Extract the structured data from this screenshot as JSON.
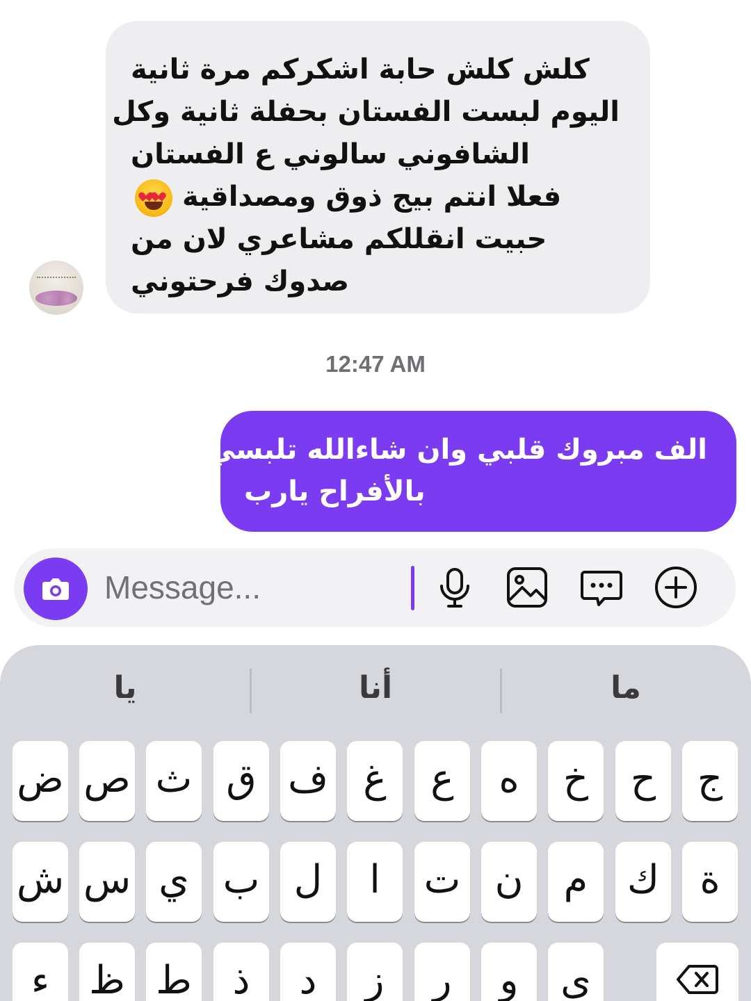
{
  "incoming": {
    "lines": [
      "كلش كلش حابة اشكركم مرة ثانية",
      "اليوم لبست الفستان بحفلة ثانية وكل",
      "الشافوني سالوني ع الفستان",
      "فعلا انتم بيج ذوق ومصداقية",
      "حبيت انقللكم مشاعري  لان من",
      "صدوك فرحتوني"
    ],
    "emoji": "heart-eyes-emoji"
  },
  "timestamp": "12:47 AM",
  "outgoing": {
    "lines": [
      "الف مبروك قلبي وان شاءالله تلبسي",
      "بالأفراح يارب"
    ]
  },
  "composer": {
    "placeholder": "Message...",
    "icons": [
      "camera-icon",
      "microphone-icon",
      "gallery-icon",
      "sticker-chat-icon",
      "plus-circle-icon"
    ]
  },
  "keyboard": {
    "suggestions": [
      "يا",
      "أنا",
      "ما"
    ],
    "row1": [
      "ض",
      "ص",
      "ث",
      "ق",
      "ف",
      "غ",
      "ع",
      "ه",
      "خ",
      "ح",
      "ج"
    ],
    "row2": [
      "ش",
      "س",
      "ي",
      "ب",
      "ل",
      "ا",
      "ت",
      "ن",
      "م",
      "ك",
      "ة"
    ],
    "row3": [
      "ء",
      "ظ",
      "ط",
      "ذ",
      "د",
      "ز",
      "ر",
      "و",
      "ى"
    ],
    "delete_icon": "delete-icon"
  },
  "colors": {
    "accent": "#7b3bf0",
    "incoming_bubble": "#eeeef1",
    "keyboard_bg": "#d5d7dd"
  }
}
